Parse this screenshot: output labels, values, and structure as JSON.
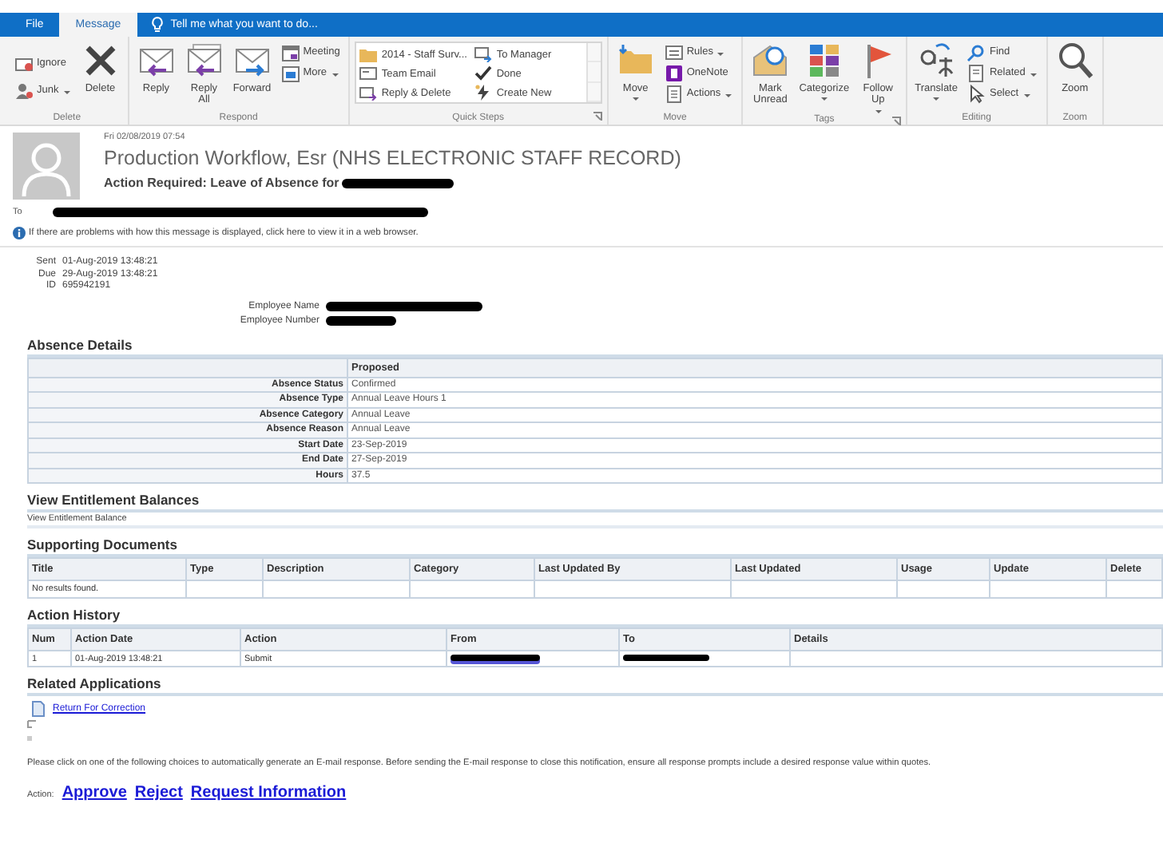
{
  "ribbon": {
    "tabs": [
      {
        "label": "File",
        "selected": false
      },
      {
        "label": "Message",
        "selected": true
      }
    ],
    "tell_me": "Tell me what you want to do...",
    "groups": [
      {
        "label": "Delete",
        "launcher": false,
        "commands": [
          {
            "kind": "small",
            "label": "Ignore",
            "dropdown": false
          },
          {
            "kind": "small",
            "label": "Junk",
            "dropdown": true
          },
          {
            "kind": "large",
            "label": "Delete",
            "dropdown": false
          }
        ]
      },
      {
        "label": "Respond",
        "launcher": false,
        "commands": [
          {
            "kind": "large",
            "label": "Reply",
            "dropdown": false
          },
          {
            "kind": "large",
            "label": "Reply\nAll",
            "dropdown": false
          },
          {
            "kind": "large",
            "label": "Forward",
            "dropdown": false
          },
          {
            "kind": "small",
            "label": "Meeting",
            "dropdown": false
          },
          {
            "kind": "small",
            "label": "More",
            "dropdown": true
          }
        ]
      },
      {
        "label": "Quick Steps",
        "launcher": true,
        "gallery": [
          "2014 - Staff Surv...",
          "Team Email",
          "Reply & Delete",
          "To Manager",
          "Done",
          "Create New"
        ]
      },
      {
        "label": "Move",
        "launcher": false,
        "commands": [
          {
            "kind": "large",
            "label": "Move",
            "dropdown": true
          },
          {
            "kind": "small",
            "label": "Rules",
            "dropdown": true
          },
          {
            "kind": "small",
            "label": "OneNote",
            "dropdown": false
          },
          {
            "kind": "small",
            "label": "Actions",
            "dropdown": true
          }
        ]
      },
      {
        "label": "Tags",
        "launcher": true,
        "commands": [
          {
            "kind": "large",
            "label": "Mark\nUnread",
            "dropdown": false
          },
          {
            "kind": "large",
            "label": "Categorize",
            "dropdown": true
          },
          {
            "kind": "large",
            "label": "Follow\nUp",
            "dropdown": true
          }
        ]
      },
      {
        "label": "Editing",
        "launcher": false,
        "commands": [
          {
            "kind": "large",
            "label": "Translate",
            "dropdown": true
          },
          {
            "kind": "small",
            "label": "Find",
            "dropdown": false
          },
          {
            "kind": "small",
            "label": "Related",
            "dropdown": true
          },
          {
            "kind": "small",
            "label": "Select",
            "dropdown": true
          }
        ]
      },
      {
        "label": "Zoom",
        "launcher": false,
        "commands": [
          {
            "kind": "large",
            "label": "Zoom",
            "dropdown": false
          }
        ]
      }
    ]
  },
  "message": {
    "date": "Fri 02/08/2019 07:54",
    "sender": "Production Workflow, Esr (NHS ELECTRONIC STAFF RECORD)",
    "subject": "Action Required: Leave of Absence for",
    "subject_redacted": true,
    "to_label": "To",
    "to_redacted": true,
    "info": "If there are problems with how this message is displayed, click here to view it in a web browser."
  },
  "meta": [
    {
      "label": "Sent",
      "value": "01-Aug-2019 13:48:21"
    },
    {
      "label": "Due",
      "value": "29-Aug-2019 13:48:21"
    },
    {
      "label": "ID",
      "value": "695942191"
    }
  ],
  "employee": [
    {
      "label": "Employee Name",
      "value_redacted": true
    },
    {
      "label": "Employee Number",
      "value_redacted": true
    }
  ],
  "absence_details": {
    "title": "Absence Details",
    "column": "Proposed",
    "rows": [
      {
        "label": "Absence Status",
        "value": "Confirmed"
      },
      {
        "label": "Absence Type",
        "value": "Annual Leave Hours 1"
      },
      {
        "label": "Absence Category",
        "value": "Annual Leave"
      },
      {
        "label": "Absence Reason",
        "value": "Annual Leave"
      },
      {
        "label": "Start Date",
        "value": "23-Sep-2019"
      },
      {
        "label": "End Date",
        "value": "27-Sep-2019"
      },
      {
        "label": "Hours",
        "value": "37.5"
      }
    ]
  },
  "entitlement": {
    "title": "View Entitlement Balances",
    "text": "View Entitlement Balance"
  },
  "supporting_documents": {
    "title": "Supporting Documents",
    "columns": [
      "Title",
      "Type",
      "Description",
      "Category",
      "Last Updated By",
      "Last Updated",
      "Usage",
      "Update",
      "Delete"
    ],
    "empty_text": "No results found."
  },
  "action_history": {
    "title": "Action History",
    "columns": [
      "Num",
      "Action Date",
      "Action",
      "From",
      "To",
      "Details"
    ],
    "rows": [
      {
        "cells": [
          {
            "kind": "text",
            "text": "1"
          },
          {
            "kind": "text",
            "text": "01-Aug-2019 13:48:21"
          },
          {
            "kind": "text",
            "text": "Submit"
          },
          {
            "kind": "redacted_link"
          },
          {
            "kind": "redacted"
          },
          {
            "kind": "empty"
          }
        ]
      }
    ]
  },
  "related_applications": {
    "title": "Related Applications",
    "links": [
      "Return For Correction"
    ],
    "placeholders": [
      {
        "kind": "broken-image"
      },
      {
        "kind": "dot"
      }
    ]
  },
  "instructions": "Please click on one of the following choices to automatically generate an E-mail response. Before sending the E-mail response to close this notification, ensure all response prompts include a desired response value within quotes.",
  "response": {
    "label": "Action:",
    "links": [
      "Approve",
      "Reject",
      "Request Information"
    ]
  }
}
